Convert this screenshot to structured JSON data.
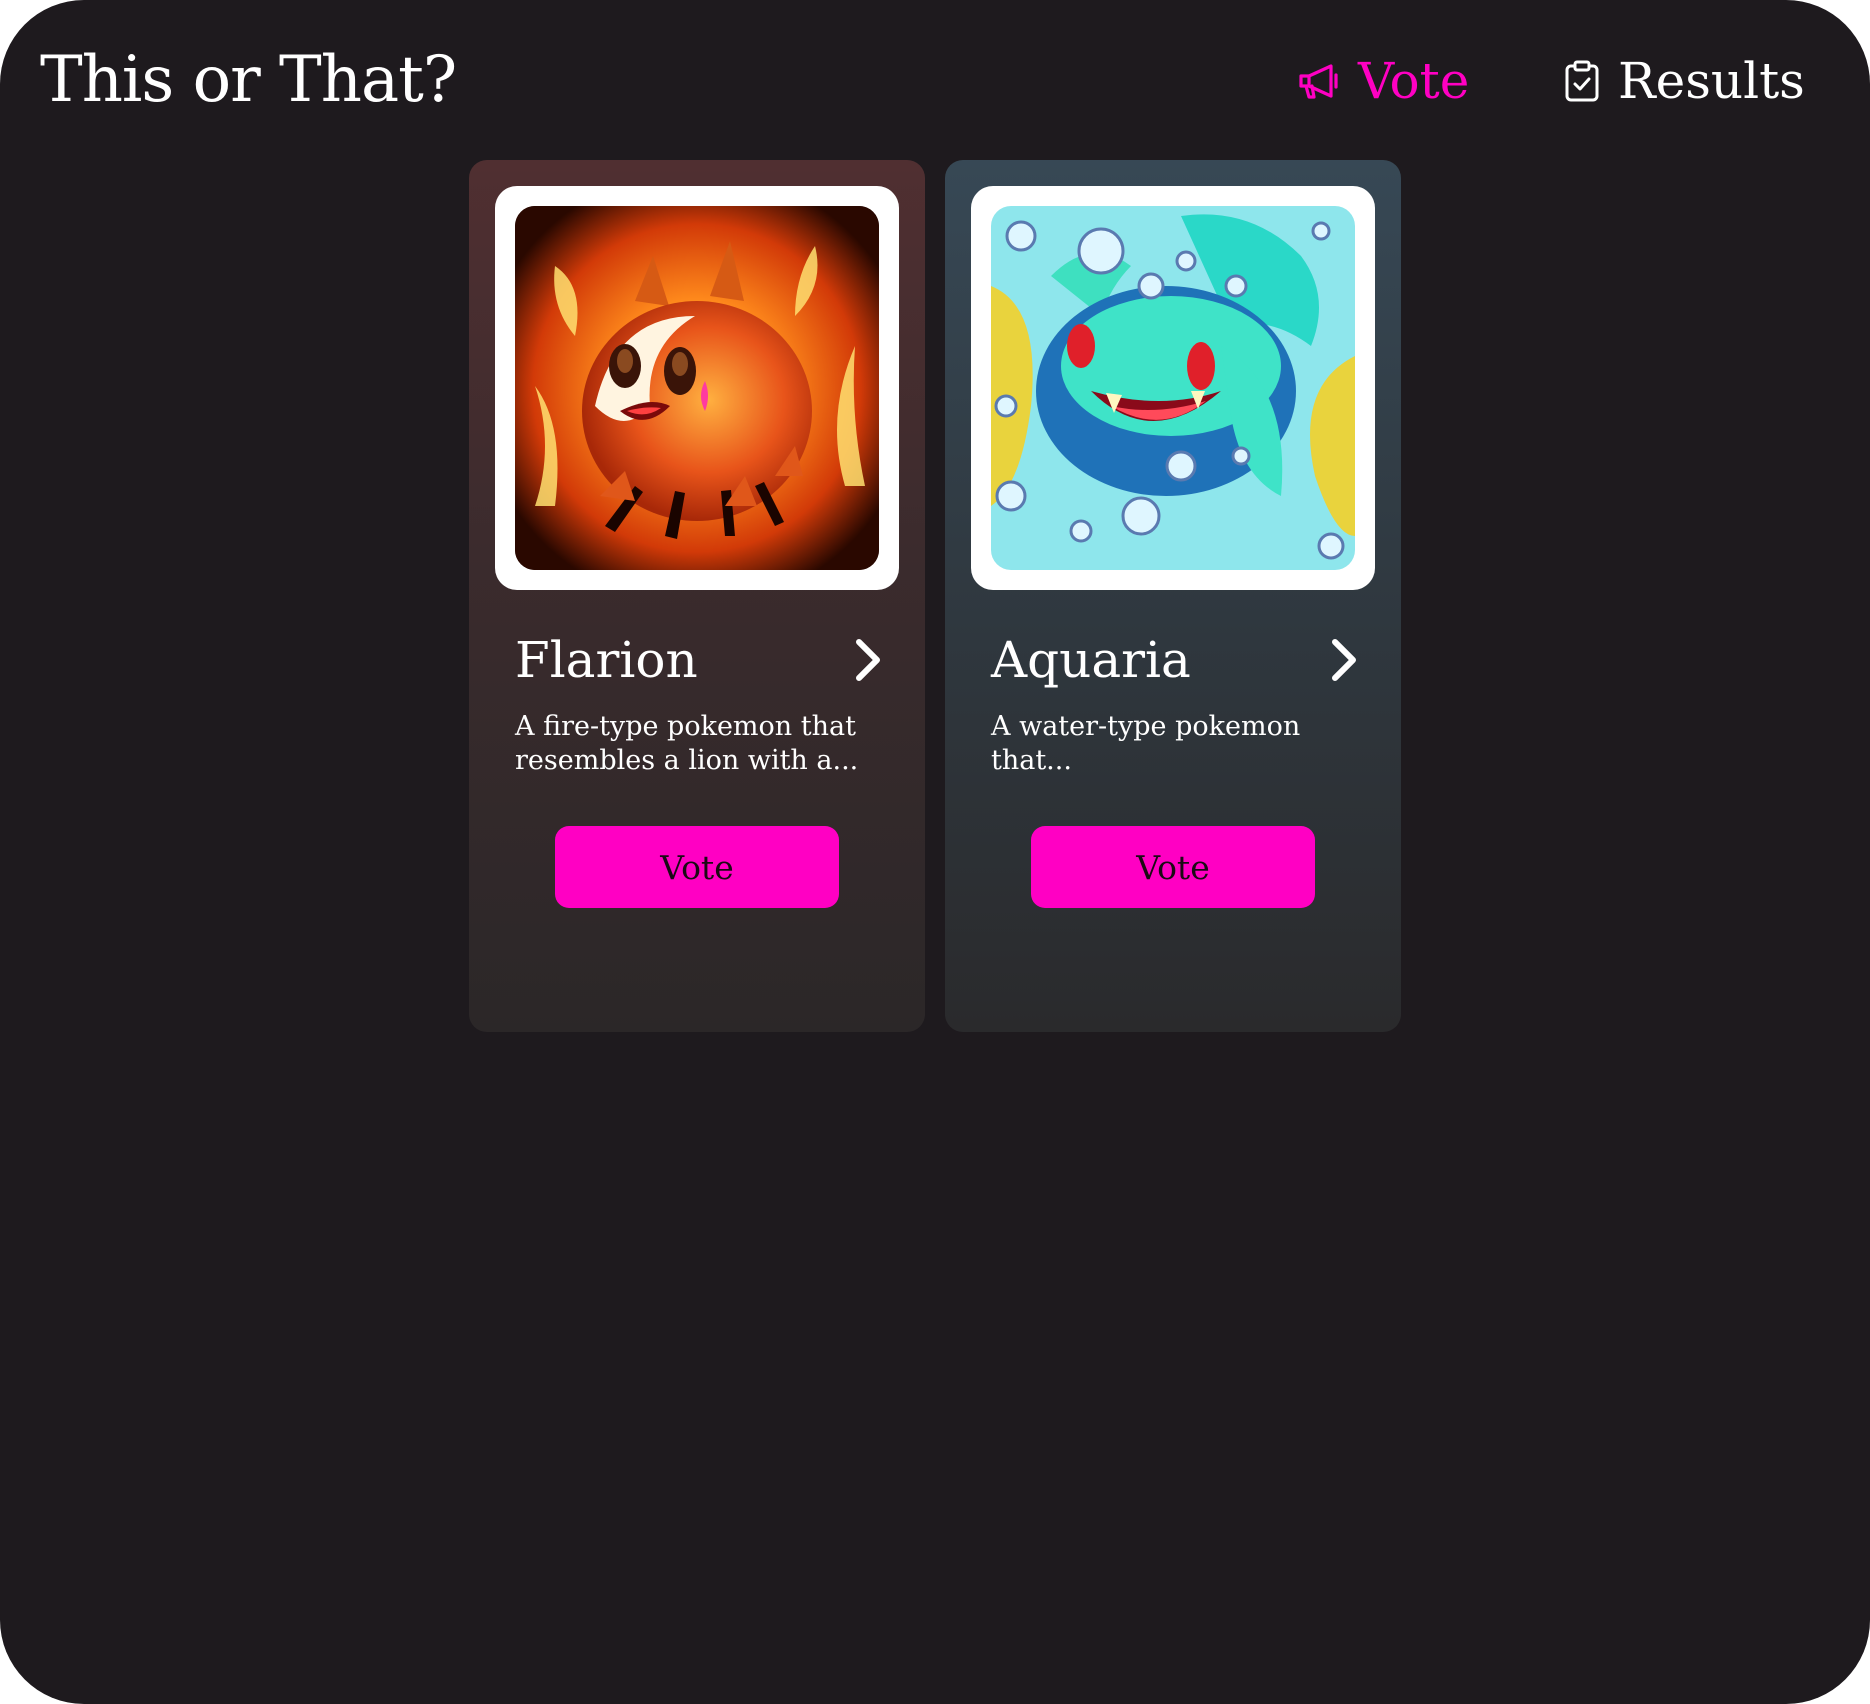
{
  "header": {
    "title": "This or That?"
  },
  "nav": {
    "vote_label": "Vote",
    "results_label": "Results",
    "active_color": "#ff00c3",
    "vote_icon": "megaphone-icon",
    "results_icon": "clipboard-check-icon"
  },
  "cards": [
    {
      "name": "Flarion",
      "description": "A fire-type pokemon that resembles a lion with a...",
      "button_label": "Vote",
      "image_icon": "fire-creature-image",
      "chevron_icon": "chevron-right-icon"
    },
    {
      "name": "Aquaria",
      "description": "A water-type pokemon that...",
      "button_label": "Vote",
      "image_icon": "water-creature-image",
      "chevron_icon": "chevron-right-icon"
    }
  ],
  "colors": {
    "background": "#1e1a1e",
    "accent": "#ff00c3",
    "card_fire_top": "#502f31",
    "card_water_top": "#374855"
  }
}
